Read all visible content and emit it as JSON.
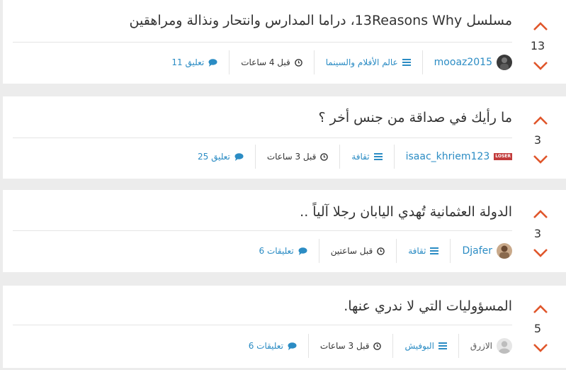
{
  "colors": {
    "vote_arrow": "#e0562b",
    "link": "#2b8cc4",
    "text": "#333333",
    "card_bg": "#ffffff",
    "page_bg": "#ececec"
  },
  "posts": [
    {
      "title": "مسلسل 13Reasons Why، دراما المدارس وانتحار ونذالة ومراهقين",
      "votes": "13",
      "author": "mooaz2015",
      "avatar_icon": "dark-avatar-photo",
      "category": "عالم الأفلام والسينما",
      "time": "قبل 4 ساعات",
      "comments": "11 تعليق"
    },
    {
      "title": "ما رأيك في صداقة من جنس أخر ؟",
      "votes": "3",
      "author": "isaac_khriem123",
      "badge": "LOSER",
      "category": "ثقافة",
      "time": "قبل 3 ساعات",
      "comments": "25 تعليق"
    },
    {
      "title": "الدولة العثمانية تُهدي اليابان رجلا آلياً ..",
      "votes": "3",
      "author": "Djafer",
      "avatar_icon": "photo-avatar",
      "category": "ثقافة",
      "time": "قبل ساعتين",
      "comments": "6 تعليقات"
    },
    {
      "title": "المسؤوليات التي لا ندري عنها.",
      "votes": "5",
      "author": "الازرق",
      "avatar_icon": "default-avatar",
      "category": "البوفيش",
      "time": "قبل 3 ساعات",
      "comments": "6 تعليقات"
    }
  ]
}
